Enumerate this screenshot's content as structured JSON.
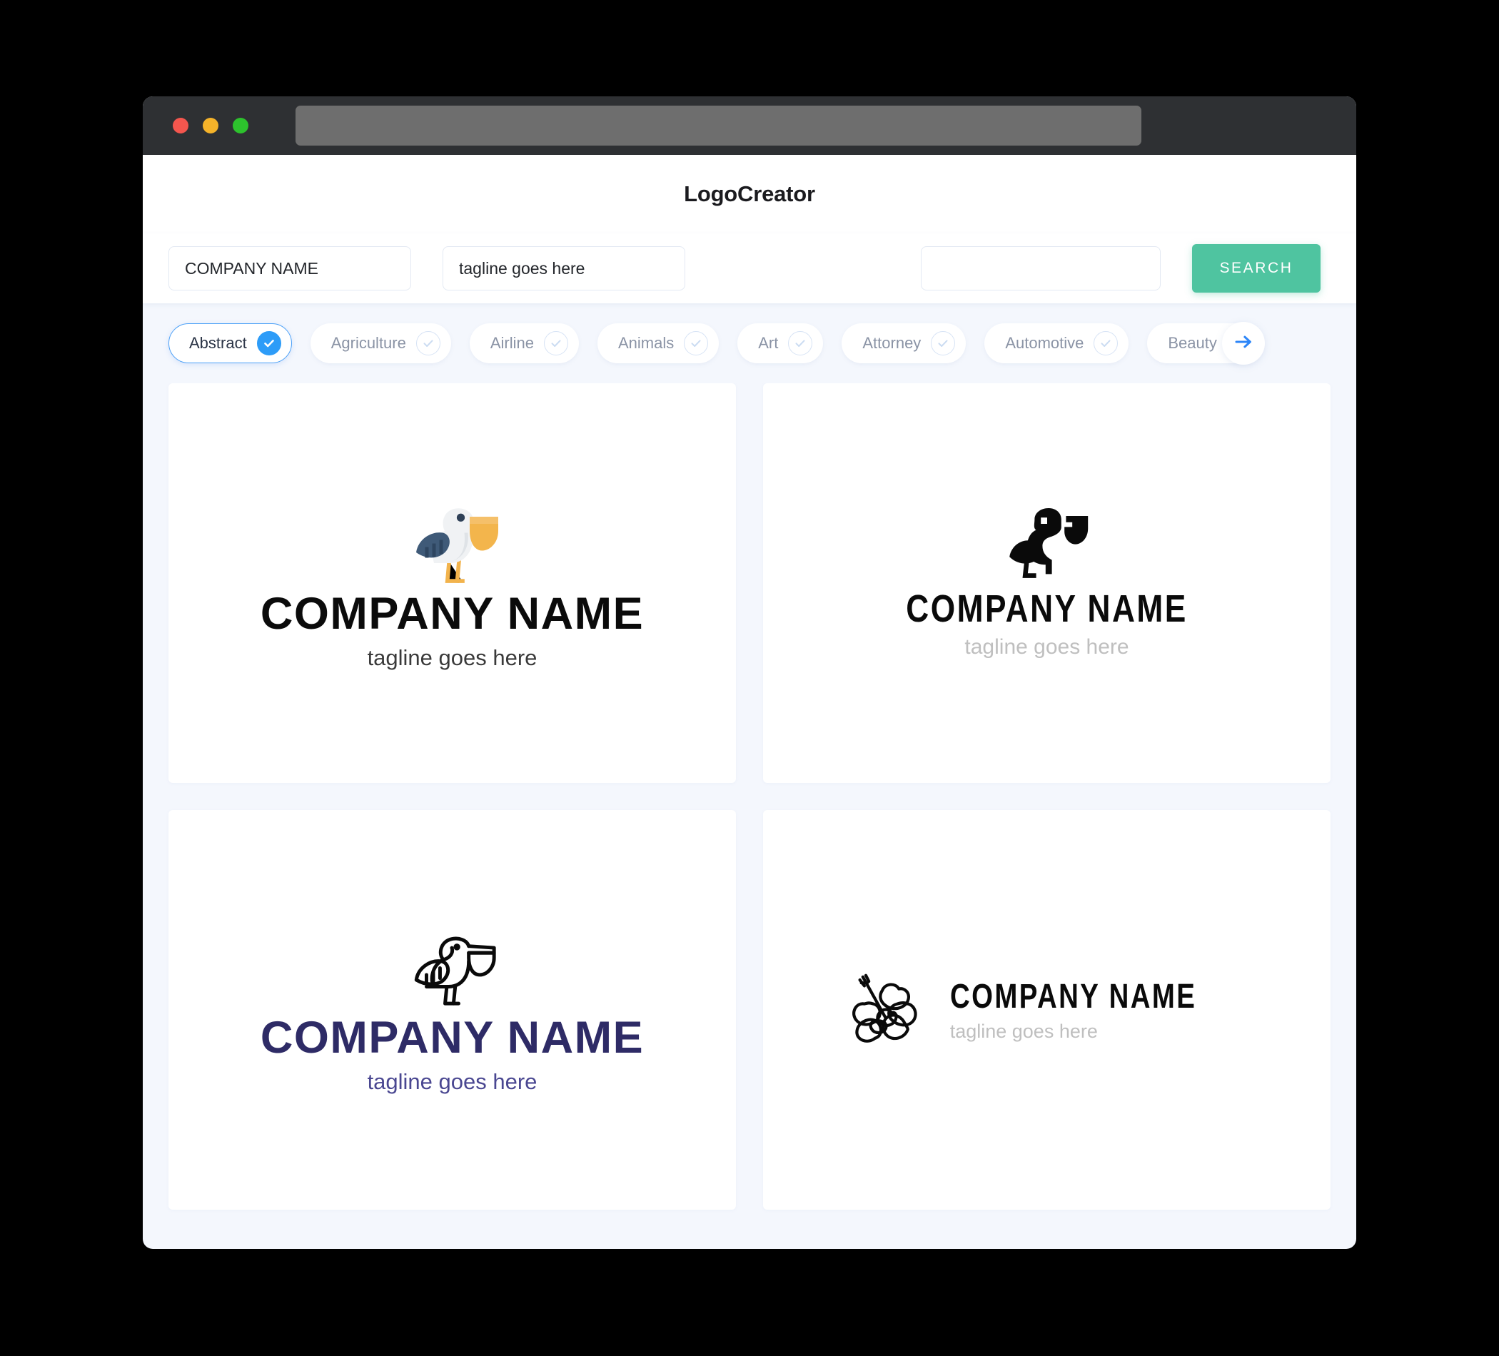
{
  "window": {
    "traffic_lights": [
      "close",
      "minimize",
      "maximize"
    ],
    "url_value": ""
  },
  "header": {
    "app_title": "LogoCreator"
  },
  "search": {
    "company_value": "COMPANY NAME",
    "company_placeholder": "COMPANY NAME",
    "tagline_value": "tagline goes here",
    "tagline_placeholder": "tagline goes here",
    "extra_value": "",
    "extra_placeholder": "",
    "button_label": "SEARCH",
    "button_color": "#4FC4A0"
  },
  "categories": {
    "next_icon": "arrow-right-icon",
    "accent_color": "#2D9CF8",
    "items": [
      {
        "label": "Abstract",
        "selected": true
      },
      {
        "label": "Agriculture",
        "selected": false
      },
      {
        "label": "Airline",
        "selected": false
      },
      {
        "label": "Animals",
        "selected": false
      },
      {
        "label": "Art",
        "selected": false
      },
      {
        "label": "Attorney",
        "selected": false
      },
      {
        "label": "Automotive",
        "selected": false
      },
      {
        "label": "Beauty",
        "selected": false
      }
    ]
  },
  "results": {
    "cards": [
      {
        "icon": "pelican-flat-color-icon",
        "name": "COMPANY NAME",
        "tagline": "tagline goes here",
        "layout": "stacked",
        "name_color": "#0B0B0B",
        "tagline_color": "#3A3A3A"
      },
      {
        "icon": "pelican-solid-black-icon",
        "name": "COMPANY NAME",
        "tagline": "tagline goes here",
        "layout": "stacked",
        "name_color": "#0A0A0A",
        "tagline_color": "#BFBFBF"
      },
      {
        "icon": "pelican-outline-icon",
        "name": "COMPANY NAME",
        "tagline": "tagline goes here",
        "layout": "stacked",
        "name_color": "#2E2B66",
        "tagline_color": "#4A4791"
      },
      {
        "icon": "hibiscus-outline-icon",
        "name": "COMPANY NAME",
        "tagline": "tagline goes here",
        "layout": "horizontal",
        "name_color": "#0A0A0A",
        "tagline_color": "#BFBFBF"
      }
    ]
  }
}
